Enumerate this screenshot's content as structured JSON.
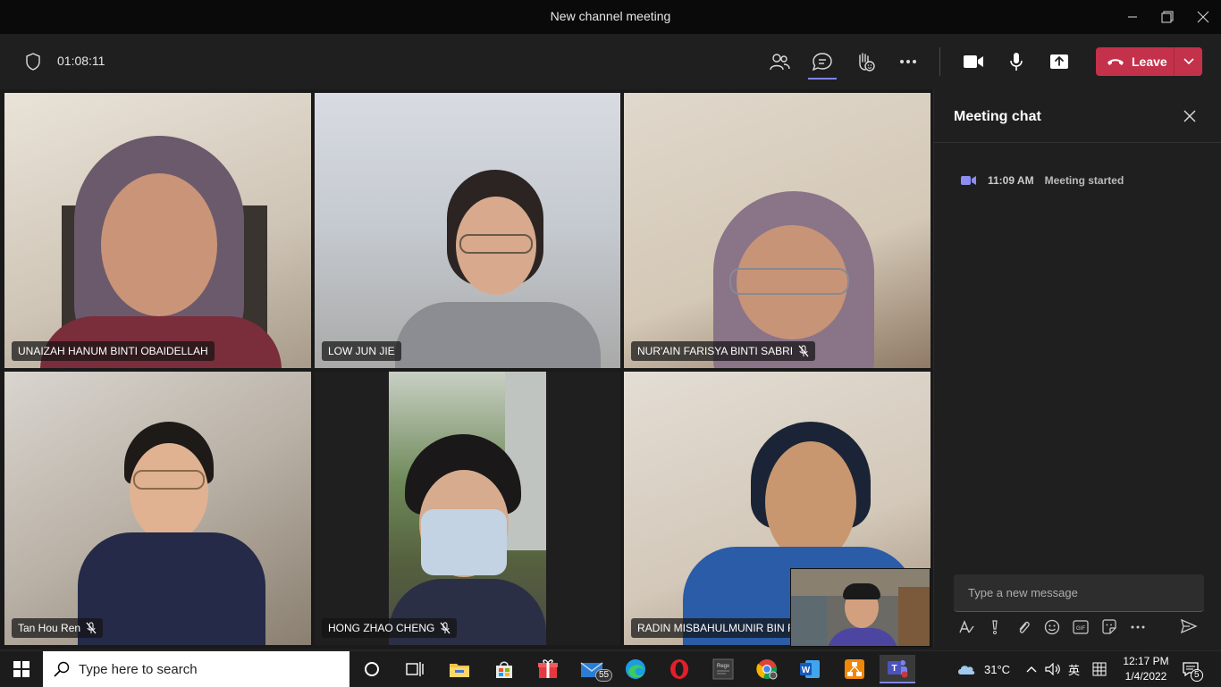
{
  "window": {
    "title": "New channel meeting"
  },
  "toolbar": {
    "timer": "01:08:11",
    "leave_label": "Leave"
  },
  "participants": [
    {
      "name": "UNAIZAH HANUM BINTI OBAIDELLAH",
      "muted": false
    },
    {
      "name": "LOW JUN JIE",
      "muted": false
    },
    {
      "name": "NUR'AIN FARISYA BINTI SABRI",
      "muted": true
    },
    {
      "name": "Tan Hou Ren",
      "muted": true
    },
    {
      "name": "HONG ZHAO CHENG",
      "muted": true
    },
    {
      "name": "RADIN MISBAHULMUNIR BIN RA",
      "muted": false
    }
  ],
  "chat": {
    "title": "Meeting chat",
    "event_time": "11:09 AM",
    "event_text": "Meeting started",
    "compose_placeholder": "Type a new message"
  },
  "taskbar": {
    "search_placeholder": "Type here to search",
    "mail_badge": "55",
    "weather": "31°C",
    "ime": "英",
    "time": "12:17 PM",
    "date": "1/4/2022",
    "notifications": "5"
  },
  "colors": {
    "accent": "#7f85f5",
    "leave": "#c4314b",
    "background": "#1f1f1f"
  }
}
